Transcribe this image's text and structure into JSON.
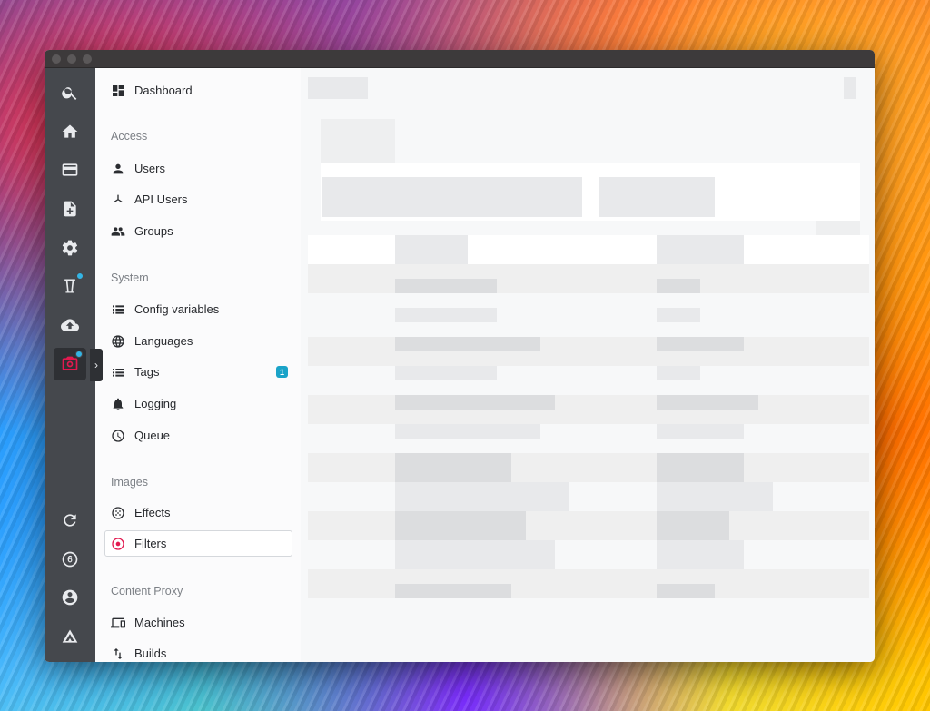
{
  "sidebar": {
    "dashboard": "Dashboard",
    "sections": {
      "access": "Access",
      "system": "System",
      "images": "Images",
      "content_proxy": "Content Proxy"
    },
    "items": {
      "users": "Users",
      "api_users": "API Users",
      "groups": "Groups",
      "config_variables": "Config variables",
      "languages": "Languages",
      "tags": "Tags",
      "tags_badge": "1",
      "logging": "Logging",
      "queue": "Queue",
      "effects": "Effects",
      "filters": "Filters",
      "machines": "Machines",
      "builds": "Builds"
    }
  },
  "rail": {
    "icons": [
      "search-icon",
      "home-icon",
      "card-icon",
      "document-add-icon",
      "gear-icon",
      "bucket-icon",
      "cloud-upload-icon",
      "image-filter-icon",
      "refresh-icon",
      "six-icon",
      "account-icon",
      "logo-icon"
    ],
    "badge_color": "#33b5e5"
  },
  "colors": {
    "rail_bg": "#45484d",
    "accent": "#e2194f",
    "badge": "#1aa3c8"
  }
}
